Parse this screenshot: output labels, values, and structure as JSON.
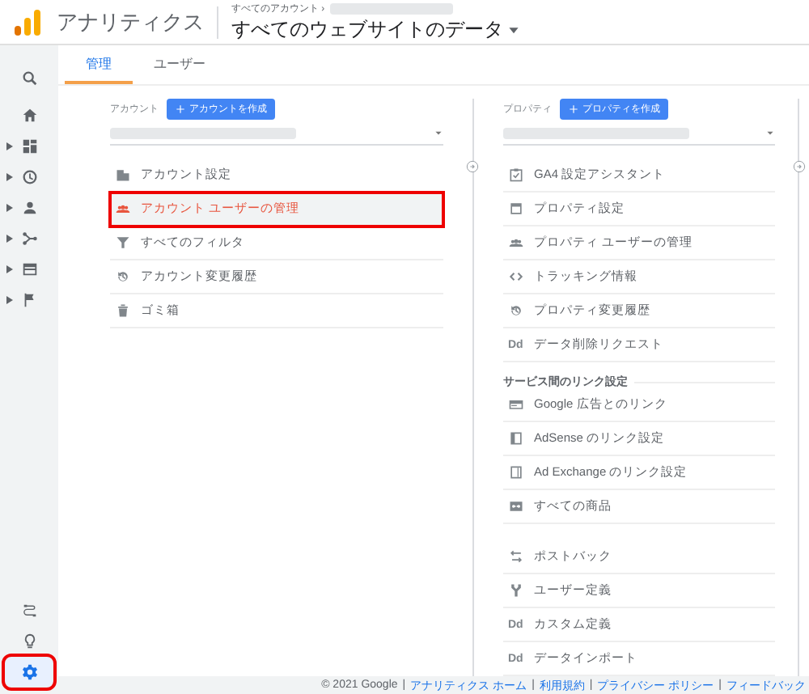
{
  "header": {
    "app_name": "アナリティクス",
    "breadcrumb": "すべてのアカウント ›",
    "view_title": "すべてのウェブサイトのデータ"
  },
  "sidebar": {
    "nav_items": [
      {
        "expandable": false,
        "selected": false
      },
      {
        "expandable": false,
        "selected": false
      },
      {
        "expandable": true,
        "selected": false
      },
      {
        "expandable": true,
        "selected": false
      },
      {
        "expandable": true,
        "selected": false
      },
      {
        "expandable": true,
        "selected": false
      },
      {
        "expandable": true,
        "selected": false
      },
      {
        "expandable": true,
        "selected": false
      }
    ],
    "bottom_items": [
      {
        "selected": false
      },
      {
        "selected": false
      },
      {
        "selected": true
      }
    ]
  },
  "tabs": [
    {
      "label": "管理",
      "selected": true
    },
    {
      "label": "ユーザー",
      "selected": false
    }
  ],
  "account_column": {
    "label": "アカウント",
    "create_button": "アカウントを作成",
    "items": [
      {
        "label": "アカウント設定",
        "selected": false
      },
      {
        "label": "アカウント ユーザーの管理",
        "selected": true
      },
      {
        "label": "すべてのフィルタ",
        "selected": false
      },
      {
        "label": "アカウント変更履歴",
        "selected": false
      },
      {
        "label": "ゴミ箱",
        "selected": false
      }
    ]
  },
  "property_column": {
    "label": "プロパティ",
    "create_button": "プロパティを作成",
    "groups": [
      {
        "items": [
          {
            "label": "GA4 設定アシスタント"
          },
          {
            "label": "プロパティ設定"
          },
          {
            "label": "プロパティ ユーザーの管理"
          },
          {
            "label": "トラッキング情報"
          },
          {
            "label": "プロパティ変更履歴"
          },
          {
            "label": "データ削除リクエスト",
            "icon_text": "Dd"
          }
        ]
      },
      {
        "heading": "サービス間のリンク設定",
        "items": [
          {
            "label": "Google 広告とのリンク"
          },
          {
            "label": "AdSense のリンク設定"
          },
          {
            "label": "Ad Exchange のリンク設定"
          },
          {
            "label": "すべての商品"
          }
        ]
      },
      {
        "items": [
          {
            "label": "ポストバック"
          },
          {
            "label": "ユーザー定義"
          },
          {
            "label": "カスタム定義",
            "icon_text": "Dd"
          },
          {
            "label": "データインポート",
            "icon_text": "Dd"
          }
        ]
      }
    ]
  },
  "footer": {
    "copyright": "© 2021 Google",
    "separator": "|",
    "links": [
      "アナリティクス ホーム",
      "利用規約",
      "プライバシー ポリシー",
      "フィードバック"
    ]
  }
}
